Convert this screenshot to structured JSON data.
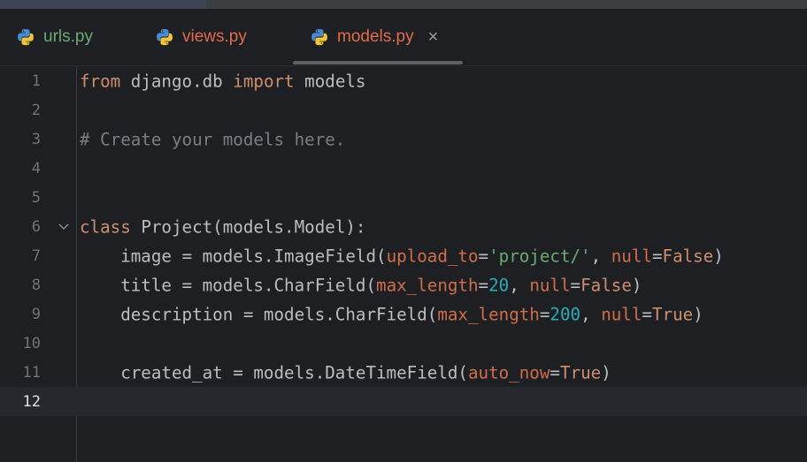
{
  "tabs": [
    {
      "label": "urls.py",
      "color": "#6aab73",
      "active": false
    },
    {
      "label": "views.py",
      "color": "#e06c4b",
      "active": false
    },
    {
      "label": "models.py",
      "color": "#e06c4b",
      "active": true,
      "close_glyph": "×"
    }
  ],
  "icons": {
    "tab_file": "python-file-icon",
    "close": "close-icon",
    "fold": "fold-chevron-icon"
  },
  "editor": {
    "current_line": 12,
    "line_numbers": [
      "1",
      "2",
      "3",
      "4",
      "5",
      "6",
      "7",
      "8",
      "9",
      "10",
      "11",
      "12"
    ],
    "lines": [
      [
        {
          "t": "from",
          "c": "kw"
        },
        {
          "t": " django.db ",
          "c": "fn"
        },
        {
          "t": "import",
          "c": "kw"
        },
        {
          "t": " models",
          "c": "fn"
        }
      ],
      [],
      [
        {
          "t": "# Create your models here.",
          "c": "cm"
        }
      ],
      [],
      [],
      [
        {
          "t": "class",
          "c": "kw"
        },
        {
          "t": " Project(models.Model):",
          "c": "fn"
        }
      ],
      [
        {
          "t": "    image = models.ImageField(",
          "c": "fn"
        },
        {
          "t": "upload_to",
          "c": "pm"
        },
        {
          "t": "=",
          "c": "fn"
        },
        {
          "t": "'project/'",
          "c": "st"
        },
        {
          "t": ", ",
          "c": "fn"
        },
        {
          "t": "null",
          "c": "pm"
        },
        {
          "t": "=",
          "c": "fn"
        },
        {
          "t": "False",
          "c": "kw"
        },
        {
          "t": ")",
          "c": "fn"
        }
      ],
      [
        {
          "t": "    title = models.CharField(",
          "c": "fn"
        },
        {
          "t": "max_length",
          "c": "pm"
        },
        {
          "t": "=",
          "c": "fn"
        },
        {
          "t": "20",
          "c": "nm"
        },
        {
          "t": ", ",
          "c": "fn"
        },
        {
          "t": "null",
          "c": "pm"
        },
        {
          "t": "=",
          "c": "fn"
        },
        {
          "t": "False",
          "c": "kw"
        },
        {
          "t": ")",
          "c": "fn"
        }
      ],
      [
        {
          "t": "    description = models.CharField(",
          "c": "fn"
        },
        {
          "t": "max_length",
          "c": "pm"
        },
        {
          "t": "=",
          "c": "fn"
        },
        {
          "t": "200",
          "c": "nm"
        },
        {
          "t": ", ",
          "c": "fn"
        },
        {
          "t": "null",
          "c": "pm"
        },
        {
          "t": "=",
          "c": "fn"
        },
        {
          "t": "True",
          "c": "kw"
        },
        {
          "t": ")",
          "c": "fn"
        }
      ],
      [],
      [
        {
          "t": "    created_at = models.DateTimeField(",
          "c": "fn"
        },
        {
          "t": "auto_now",
          "c": "pm"
        },
        {
          "t": "=",
          "c": "fn"
        },
        {
          "t": "True",
          "c": "kw"
        },
        {
          "t": ")",
          "c": "fn"
        }
      ],
      []
    ]
  }
}
